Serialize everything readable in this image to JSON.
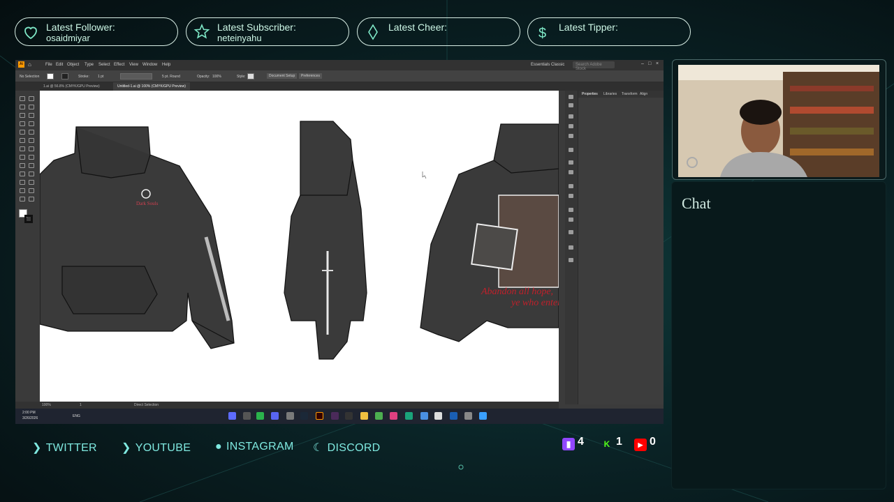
{
  "alerts": [
    {
      "label": "Latest Follower:",
      "value": "osaidmiyar",
      "icon": "heart-icon"
    },
    {
      "label": "Latest Subscriber:",
      "value": "neteinyahu",
      "icon": "star-icon"
    },
    {
      "label": "Latest Cheer:",
      "value": "",
      "icon": "diamond-icon"
    },
    {
      "label": "Latest Tipper:",
      "value": "",
      "icon": "dollar-icon"
    }
  ],
  "app": {
    "menu": [
      "File",
      "Edit",
      "Object",
      "Type",
      "Select",
      "Effect",
      "View",
      "Window",
      "Help"
    ],
    "workspace": "Essentials Classic",
    "search_placeholder": "Search Adobe Stock",
    "control": {
      "selection": "No Selection",
      "stroke_label": "Stroke:",
      "stroke_value": "1 pt",
      "brush": "5 pt. Round",
      "opacity_label": "Opacity:",
      "opacity_value": "100%",
      "style_label": "Style:",
      "doc_setup": "Document Setup",
      "preferences": "Preferences"
    },
    "tabs": [
      {
        "label": "1.ai @ 56.8% (CMYK/GPU Preview)",
        "active": false
      },
      {
        "label": "Untitled-1.ai @ 100% (CMYK/GPU Preview)",
        "active": true
      }
    ],
    "panel_tabs": [
      "Properties",
      "Libraries",
      "Transform",
      "Align"
    ],
    "status": {
      "zoom": "100%",
      "page": "1",
      "tool": "Direct Selection"
    },
    "artwork": {
      "front_chest_text": "Dark Souls",
      "back_print_text_1": "Abandon all hope,",
      "back_print_text_2": "ye who enter"
    }
  },
  "taskbar": {
    "time": "2:00 PM",
    "date": "3/26/2026",
    "lang": "ENG"
  },
  "chat": {
    "title": "Chat"
  },
  "socials": [
    {
      "label": "TWITTER",
      "icon": "chevron-right-icon"
    },
    {
      "label": "YOUTUBE",
      "icon": "chevron-right-icon"
    },
    {
      "label": "INSTAGRAM",
      "icon": "circle-icon"
    },
    {
      "label": "DISCORD",
      "icon": "crescent-icon"
    }
  ],
  "counters": [
    {
      "platform": "twitch",
      "value": "4",
      "color": "#9146ff"
    },
    {
      "platform": "kick",
      "value": "1",
      "color": "#53fc18"
    },
    {
      "platform": "youtube",
      "value": "0",
      "color": "#ff0000"
    }
  ]
}
